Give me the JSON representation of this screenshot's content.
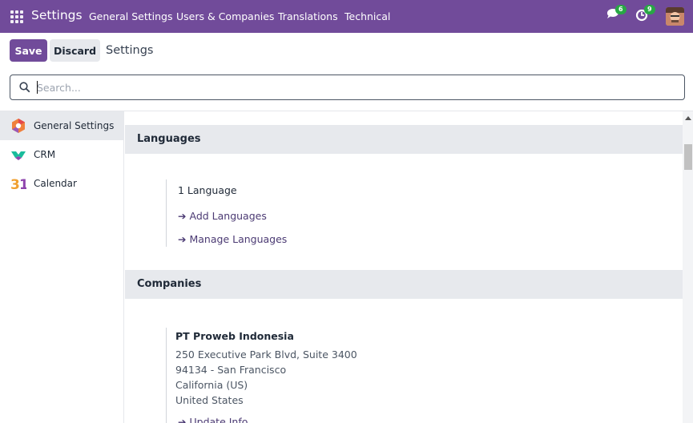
{
  "navbar": {
    "brand": "Settings",
    "menu": [
      "General Settings",
      "Users & Companies",
      "Translations",
      "Technical"
    ],
    "messages_count": "6",
    "activities_count": "9"
  },
  "controlbar": {
    "save_label": "Save",
    "discard_label": "Discard",
    "breadcrumb": "Settings"
  },
  "search": {
    "placeholder": "Search..."
  },
  "sidebar": {
    "items": [
      {
        "label": "General Settings",
        "icon": "general-settings-icon",
        "active": true
      },
      {
        "label": "CRM",
        "icon": "crm-icon",
        "active": false
      },
      {
        "label": "Calendar",
        "icon": "calendar-icon",
        "active": false
      }
    ]
  },
  "languages": {
    "heading": "Languages",
    "count_text": "1 Language",
    "add_link": "Add Languages",
    "manage_link": "Manage Languages"
  },
  "companies": {
    "heading": "Companies",
    "name": "PT Proweb Indonesia",
    "address_lines": [
      "250 Executive Park Blvd, Suite 3400",
      "94134 - San Francisco",
      "California (US)",
      "United States"
    ],
    "update_link": "Update Info"
  },
  "colors": {
    "navbar": "#714b9a",
    "primary": "#714b9a",
    "badge": "#28a745"
  }
}
